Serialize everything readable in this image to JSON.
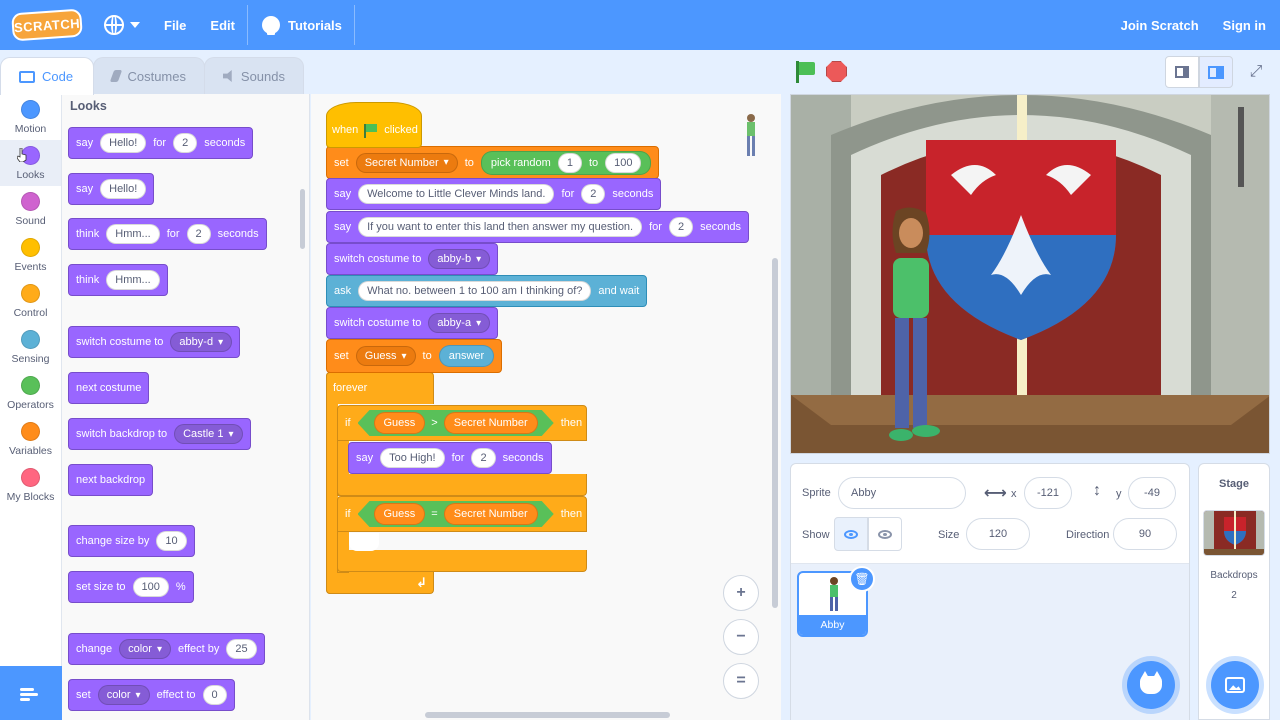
{
  "menu": {
    "logo": "SCRATCH",
    "file": "File",
    "edit": "Edit",
    "tutorials": "Tutorials",
    "join": "Join Scratch",
    "signin": "Sign in"
  },
  "tabs": {
    "code": "Code",
    "costumes": "Costumes",
    "sounds": "Sounds"
  },
  "categories": [
    {
      "label": "Motion",
      "color": "#4c97ff"
    },
    {
      "label": "Looks",
      "color": "#9966ff"
    },
    {
      "label": "Sound",
      "color": "#cf63cf"
    },
    {
      "label": "Events",
      "color": "#ffbf00"
    },
    {
      "label": "Control",
      "color": "#ffab19"
    },
    {
      "label": "Sensing",
      "color": "#5cb1d6"
    },
    {
      "label": "Operators",
      "color": "#59c059"
    },
    {
      "label": "Variables",
      "color": "#ff8c1a"
    },
    {
      "label": "My Blocks",
      "color": "#ff6680"
    }
  ],
  "palette": {
    "title": "Looks",
    "say_for": {
      "say": "say",
      "msg": "Hello!",
      "for": "for",
      "secs": "2",
      "seconds": "seconds"
    },
    "say": {
      "say": "say",
      "msg": "Hello!"
    },
    "think_for": {
      "think": "think",
      "msg": "Hmm...",
      "for": "for",
      "secs": "2",
      "seconds": "seconds"
    },
    "think": {
      "think": "think",
      "msg": "Hmm..."
    },
    "switch_costume": {
      "label": "switch costume to",
      "value": "abby-d"
    },
    "next_costume": "next costume",
    "switch_backdrop": {
      "label": "switch backdrop to",
      "value": "Castle 1"
    },
    "next_backdrop": "next backdrop",
    "change_size": {
      "label": "change size by",
      "value": "10"
    },
    "set_size": {
      "label": "set size to",
      "value": "100",
      "unit": "%"
    },
    "change_effect": {
      "change": "change",
      "effect": "color",
      "by": "effect by",
      "value": "25"
    },
    "set_effect": {
      "set": "set",
      "effect": "color",
      "to": "effect to",
      "value": "0"
    }
  },
  "script": {
    "hat": {
      "when": "when",
      "clicked": "clicked"
    },
    "set_secret": {
      "set": "set",
      "var": "Secret Number",
      "to": "to",
      "pick": "pick random",
      "from": "1",
      "to2": "to",
      "max": "100"
    },
    "say_welcome": {
      "say": "say",
      "msg": "Welcome to Little Clever Minds land.",
      "for": "for",
      "secs": "2",
      "seconds": "seconds"
    },
    "say_enter": {
      "say": "say",
      "msg": "If you want to enter this land then answer my question.",
      "for": "for",
      "secs": "2",
      "seconds": "seconds"
    },
    "costume_b": {
      "label": "switch costume to",
      "value": "abby-b"
    },
    "ask": {
      "ask": "ask",
      "msg": "What no. between 1 to 100 am I thinking of?",
      "wait": "and wait"
    },
    "costume_a": {
      "label": "switch costume to",
      "value": "abby-a"
    },
    "set_guess": {
      "set": "set",
      "var": "Guess",
      "to": "to",
      "value": "answer"
    },
    "forever": "forever",
    "if1": {
      "if": "if",
      "left": "Guess",
      "op": ">",
      "right": "Secret Number",
      "then": "then"
    },
    "say_high": {
      "say": "say",
      "msg": "Too High!",
      "for": "for",
      "secs": "2",
      "seconds": "seconds"
    },
    "if2": {
      "if": "if",
      "left": "Guess",
      "op": "=",
      "right": "Secret Number",
      "then": "then"
    }
  },
  "zoom": {
    "in": "+",
    "out": "−",
    "reset": "="
  },
  "sprite_info": {
    "sprite_label": "Sprite",
    "sprite_name": "Abby",
    "x_label": "x",
    "x_value": "-121",
    "y_label": "y",
    "y_value": "-49",
    "show_label": "Show",
    "size_label": "Size",
    "size_value": "120",
    "direction_label": "Direction",
    "direction_value": "90"
  },
  "sprites": [
    {
      "name": "Abby"
    }
  ],
  "stage_pane": {
    "title": "Stage",
    "backdrops_label": "Backdrops",
    "backdrops_count": "2"
  }
}
